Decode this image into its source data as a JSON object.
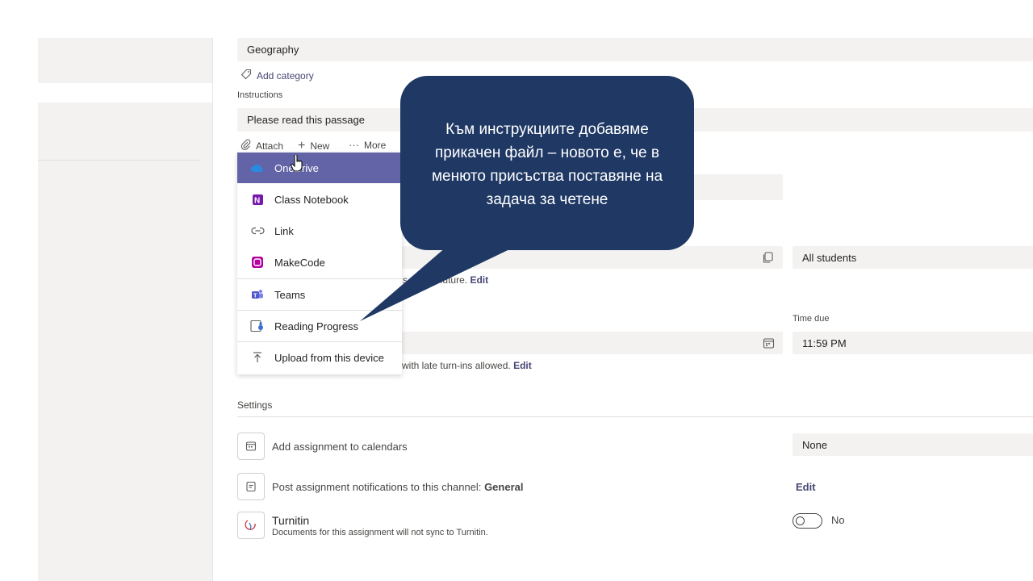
{
  "form": {
    "category_value": "Geography",
    "add_category_label": "Add category",
    "instructions_label": "Instructions",
    "instructions_value": "Please read this passage",
    "attach_label": "Attach",
    "new_label": "New",
    "more_label": "More",
    "assign_to_value": "All students",
    "schedule_note": "future.",
    "schedule_edit": "Edit",
    "time_due_label": "Time due",
    "time_due_value": "11:59 PM",
    "late_note": "with late turn-ins allowed.",
    "late_edit": "Edit"
  },
  "attach_menu": {
    "items": [
      {
        "label": "OneDrive",
        "icon": "onedrive-icon"
      },
      {
        "label": "Class Notebook",
        "icon": "onenote-icon"
      },
      {
        "label": "Link",
        "icon": "link-icon"
      },
      {
        "label": "MakeCode",
        "icon": "makecode-icon"
      },
      {
        "label": "Teams",
        "icon": "teams-icon"
      },
      {
        "label": "Reading Progress",
        "icon": "reading-progress-icon"
      },
      {
        "label": "Upload from this device",
        "icon": "upload-icon"
      }
    ]
  },
  "callout": {
    "text": "Към инструкциите добавяме прикачен файл – новото е, че в менюто присъства поставяне на задача за четене"
  },
  "settings": {
    "title": "Settings",
    "calendar_label": "Add assignment to calendars",
    "calendar_value": "None",
    "notify_label": "Post assignment notifications to this channel:",
    "notify_channel": "General",
    "notify_edit": "Edit",
    "turnitin_title": "Turnitin",
    "turnitin_note": "Documents for this assignment will not sync to Turnitin.",
    "turnitin_toggle_label": "No",
    "turnitin_enabled": false
  },
  "colors": {
    "accent": "#6264a7",
    "callout_bg": "#1f3864",
    "field_bg": "#f3f2f1"
  }
}
